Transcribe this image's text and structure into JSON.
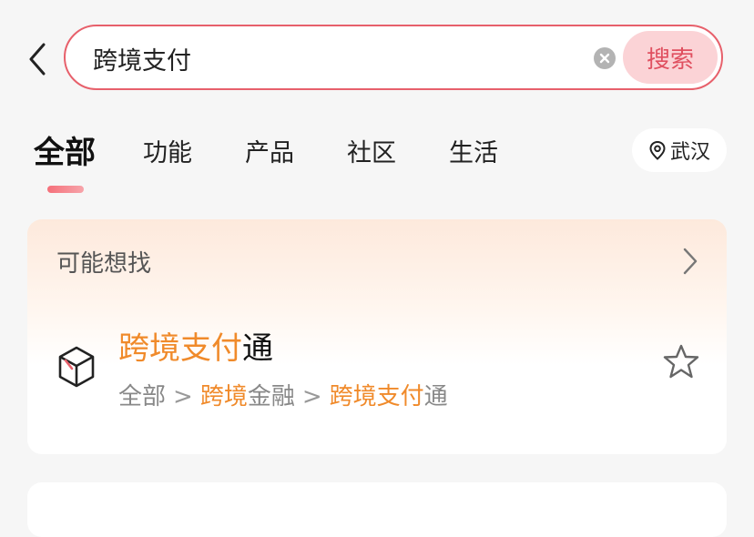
{
  "search": {
    "value": "跨境支付",
    "button_label": "搜索"
  },
  "tabs": [
    {
      "label": "全部",
      "active": true
    },
    {
      "label": "功能",
      "active": false
    },
    {
      "label": "产品",
      "active": false
    },
    {
      "label": "社区",
      "active": false
    },
    {
      "label": "生活",
      "active": false
    }
  ],
  "location": {
    "label": "武汉",
    "icon": "location-pin-icon"
  },
  "suggestion_card": {
    "header": "可能想找",
    "result": {
      "title_highlight": "跨境支付",
      "title_rest": "通",
      "path": {
        "part1": "全部",
        "separator": ">",
        "part2_highlight": "跨境",
        "part2_rest": "金融",
        "part3_highlight": "跨境支付",
        "part3_rest": "通"
      }
    }
  },
  "colors": {
    "accent": "#e7606b",
    "highlight": "#f08a2a",
    "button_bg": "#fbd3d6"
  }
}
